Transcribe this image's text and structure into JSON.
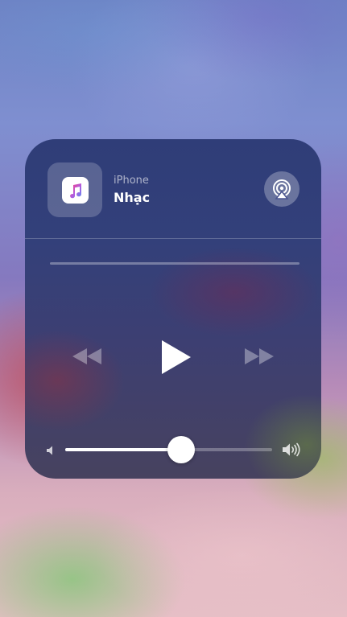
{
  "now_playing": {
    "device_label": "iPhone",
    "track_title": "Nhạc",
    "app_icon": "music-note-icon",
    "airplay_icon": "airplay-icon"
  },
  "playback": {
    "rewind_icon": "rewind-icon",
    "play_icon": "play-icon",
    "fast_forward_icon": "fast-forward-icon",
    "progress": 0
  },
  "volume": {
    "level": 0.56,
    "low_icon": "speaker-low-icon",
    "high_icon": "speaker-high-icon"
  },
  "colors": {
    "card_background": "#34407a",
    "music_note_pink": "#fc3c7c",
    "music_note_blue": "#5b8cf0"
  }
}
